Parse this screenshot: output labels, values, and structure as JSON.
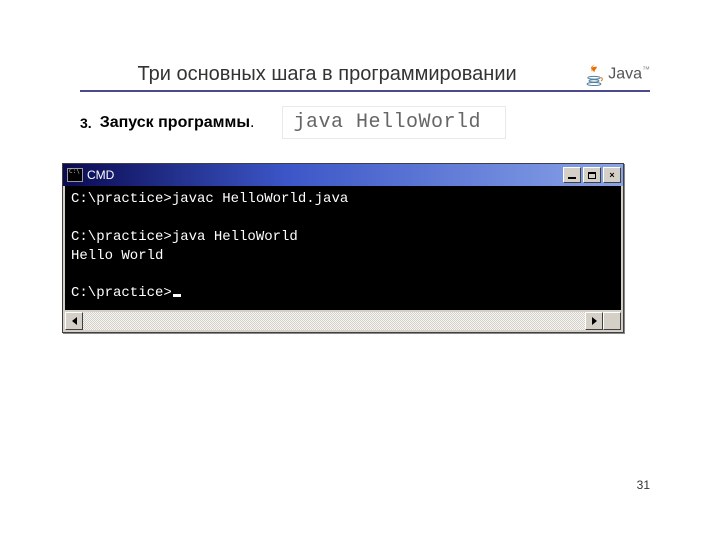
{
  "slide": {
    "title": "Три основных шага в программировании",
    "step_number": "3.",
    "step_text": "Запуск программы",
    "step_dot": ".",
    "command_sample": "java HelloWorld",
    "page_number": "31"
  },
  "logo": {
    "word": "Java",
    "tm": "™",
    "icon_name": "java-cup"
  },
  "cmd": {
    "title": "CMD",
    "lines": [
      "C:\\practice>javac HelloWorld.java",
      "",
      "C:\\practice>java HelloWorld",
      "Hello World",
      "",
      "C:\\practice>"
    ],
    "buttons": {
      "min": "minimize",
      "max": "maximize",
      "close": "×"
    }
  }
}
